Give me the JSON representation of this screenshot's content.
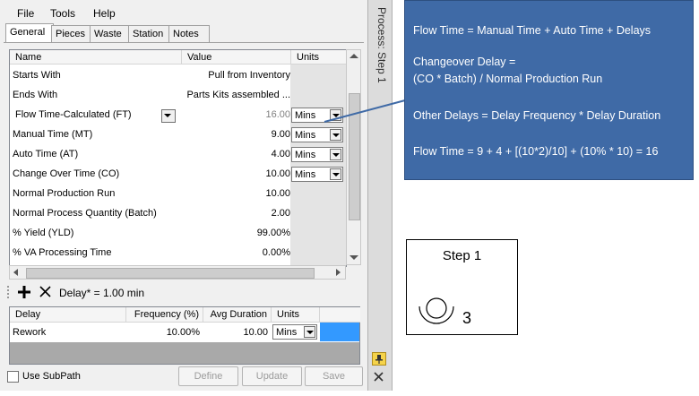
{
  "menu": [
    "File",
    "Tools",
    "Help"
  ],
  "tabs": [
    "General",
    "Pieces",
    "Waste",
    "Station",
    "Notes"
  ],
  "grid": {
    "headers": [
      "Name",
      "Value",
      "Units"
    ],
    "rows": [
      {
        "name": "Starts With",
        "value": "Pull from Inventory",
        "unit": ""
      },
      {
        "name": "Ends With",
        "value": "Parts Kits assembled ...",
        "unit": ""
      },
      {
        "name": "Flow Time-Calculated (FT)",
        "value": "16.00",
        "unit": "Mins"
      },
      {
        "name": "Manual Time (MT)",
        "value": "9.00",
        "unit": "Mins"
      },
      {
        "name": "Auto Time (AT)",
        "value": "4.00",
        "unit": "Mins"
      },
      {
        "name": "Change Over Time (CO)",
        "value": "10.00",
        "unit": "Mins"
      },
      {
        "name": "Normal Production Run",
        "value": "10.00",
        "unit": ""
      },
      {
        "name": "Normal Process Quantity (Batch)",
        "value": "2.00",
        "unit": ""
      },
      {
        "name": "% Yield (YLD)",
        "value": "99.00%",
        "unit": ""
      },
      {
        "name": "% VA Processing Time",
        "value": "0.00%",
        "unit": ""
      }
    ]
  },
  "delay_toolbar": {
    "label": "Delay* = 1.00 min"
  },
  "delay_grid": {
    "headers": [
      "Delay",
      "Frequency (%)",
      "Avg Duration",
      "Units"
    ],
    "rows": [
      {
        "delay": "Rework",
        "frequency": "10.00%",
        "duration": "10.00",
        "unit": "Mins"
      }
    ]
  },
  "bottom": {
    "checkbox_label": "Use SubPath",
    "define": "Define",
    "update": "Update",
    "save": "Save"
  },
  "side_title": "Process:  Step 1",
  "callout": {
    "line1": "Flow Time  = Manual Time + Auto Time + Delays",
    "line2": "Changeover Delay  =",
    "line3": "(CO * Batch) / Normal Production Run",
    "line4": "Other Delays = Delay Frequency * Delay Duration",
    "line5": "Flow Time = 9 + 4 + [(10*2)/10] + (10% * 10) = 16",
    "color": "#3f6aa6"
  },
  "step": {
    "title": "Step 1",
    "count": "3"
  }
}
